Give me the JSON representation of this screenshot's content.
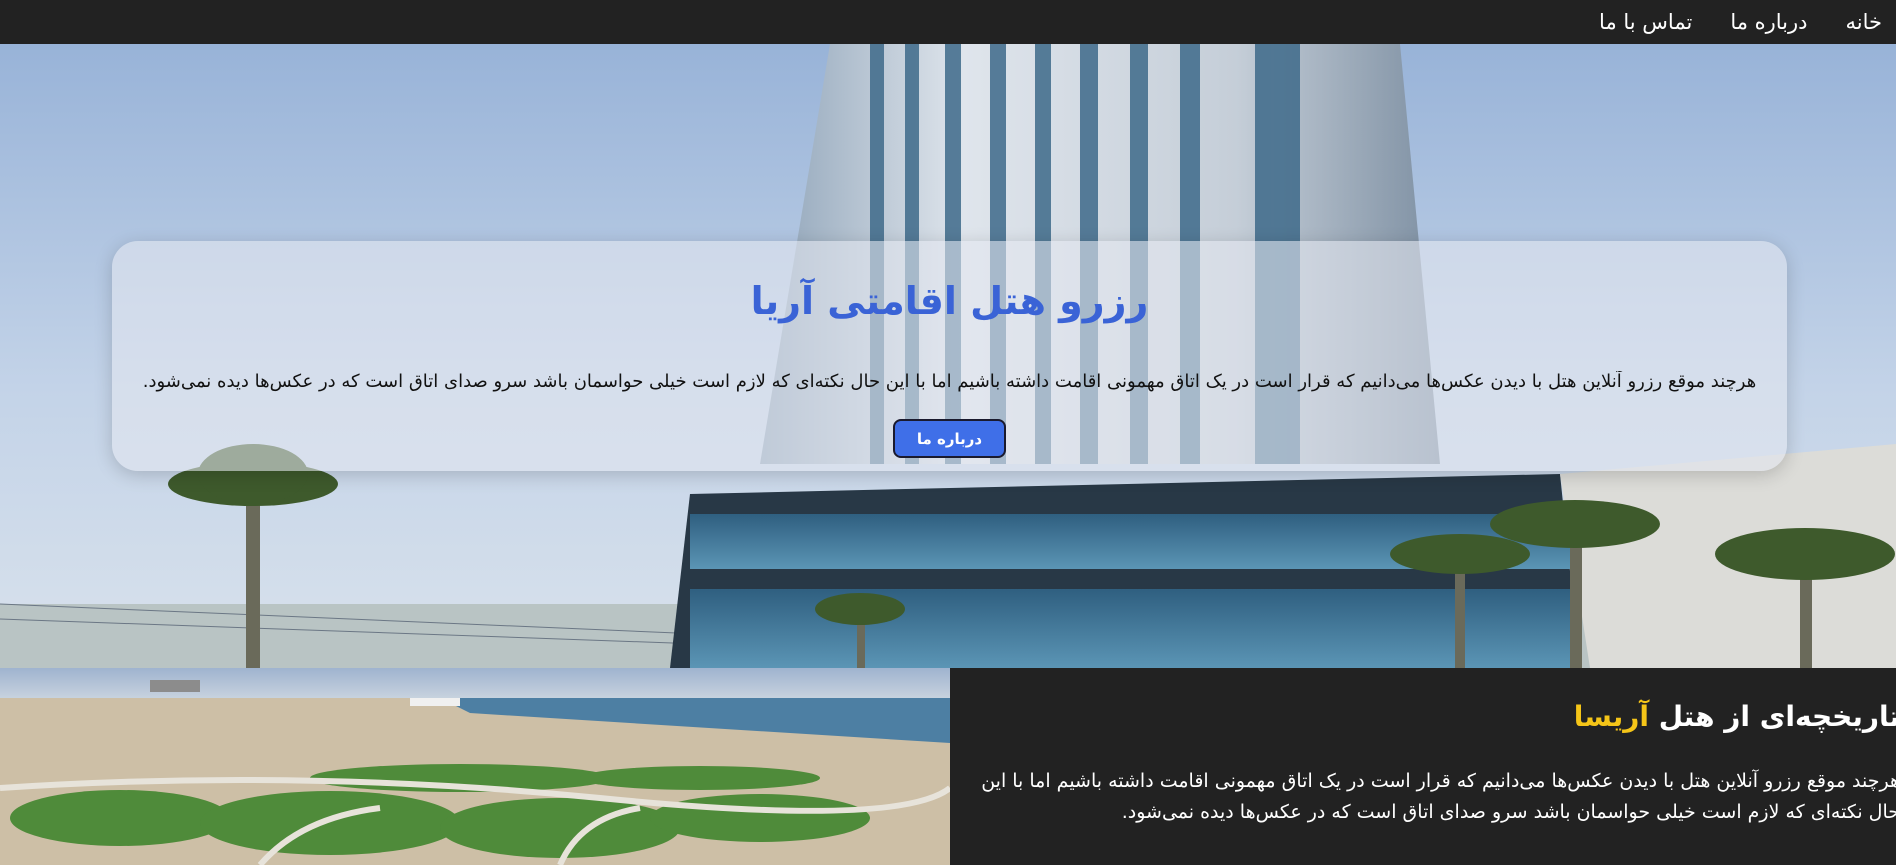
{
  "nav": {
    "items": [
      {
        "label": "خانه"
      },
      {
        "label": "درباره ما"
      },
      {
        "label": "تماس با ما"
      }
    ]
  },
  "hero": {
    "title": "رزرو هتل اقامتی آریا",
    "text": "هرچند موقع رزرو آنلاین هتل با دیدن عکس‌ها می‌دانیم که قرار است در یک اتاق مهمونی اقامت داشته باشیم اما با این حال نکته‌ای که لازم است خیلی حواسمان باشد سرو صدای اتاق است که در عکس‌ها دیده نمی‌شود.",
    "button_label": "درباره ما"
  },
  "history": {
    "title_prefix": "تاریخچه‌ای از هتل",
    "title_accent": "آریسا",
    "paragraph": "هرچند موقع رزرو آنلاین هتل با دیدن عکس‌ها می‌دانیم که قرار است در یک اتاق مهمونی اقامت داشته باشیم اما با این حال نکته‌ای که لازم است خیلی حواسمان باشد سرو صدای اتاق است که در عکس‌ها دیده نمی‌شود."
  },
  "colors": {
    "nav_bg": "#222222",
    "hero_title": "#3a63d6",
    "button_bg": "#3f6fe8",
    "accent_yellow": "#f5c518"
  }
}
